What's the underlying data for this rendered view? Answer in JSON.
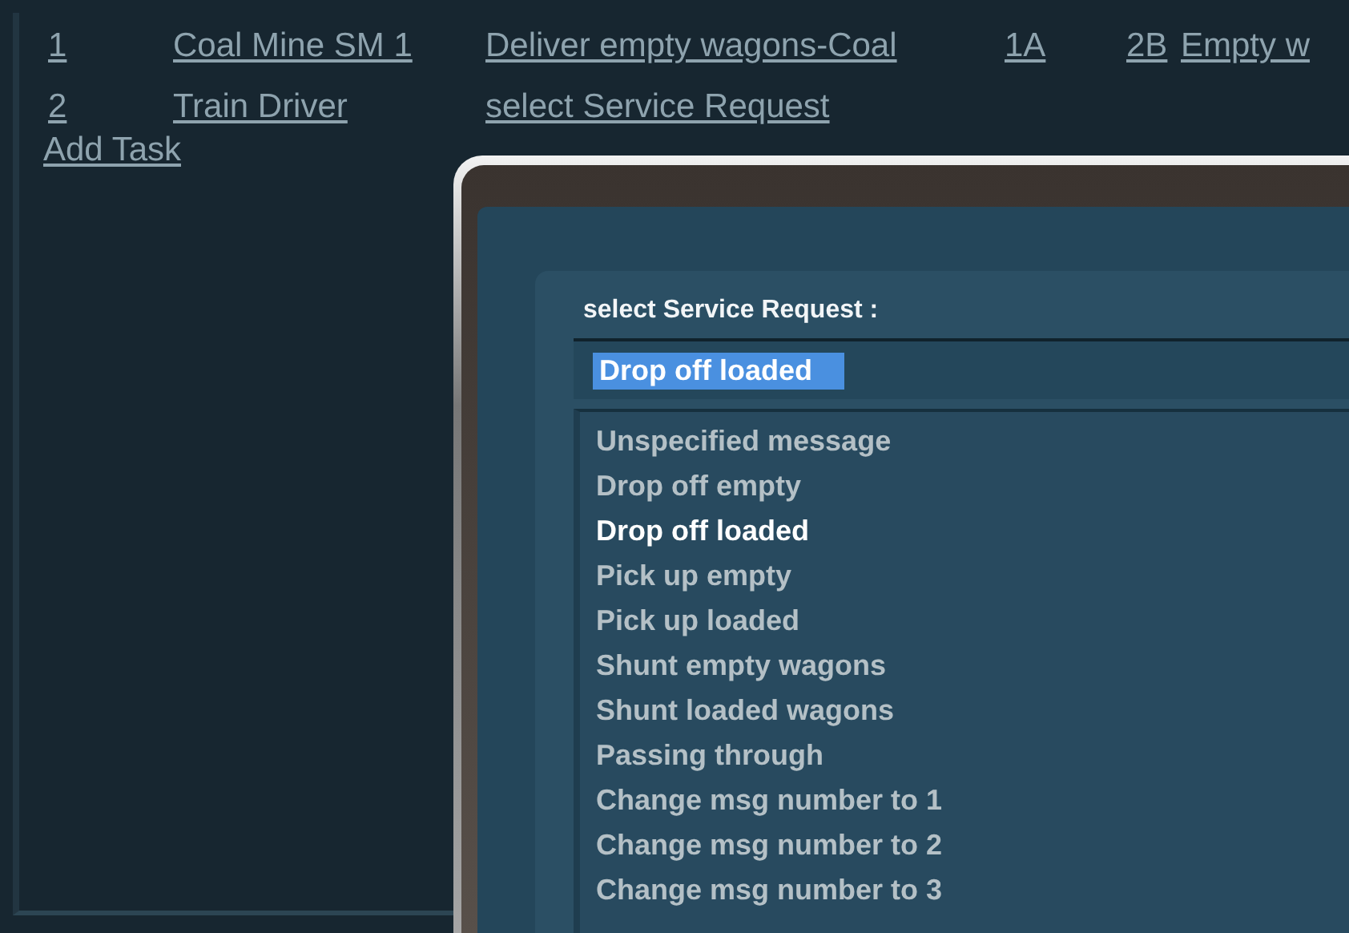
{
  "tasks": [
    {
      "number": "1",
      "cells": [
        "Coal Mine SM 1",
        "Deliver empty wagons-Coal",
        "1A",
        "2B",
        "Empty w"
      ]
    },
    {
      "number": "2",
      "cells": [
        "Train Driver",
        "select Service Request"
      ]
    }
  ],
  "add_task": "Add Task",
  "dialog": {
    "label": "select Service Request :",
    "value": "Drop off loaded",
    "options": [
      {
        "label": "Unspecified message",
        "selected": false
      },
      {
        "label": "Drop off empty",
        "selected": false
      },
      {
        "label": "Drop off loaded",
        "selected": true
      },
      {
        "label": "Pick up empty",
        "selected": false
      },
      {
        "label": "Pick up loaded",
        "selected": false
      },
      {
        "label": "Shunt empty wagons",
        "selected": false
      },
      {
        "label": "Shunt loaded wagons",
        "selected": false
      },
      {
        "label": "Passing through",
        "selected": false
      },
      {
        "label": "Change msg number to 1",
        "selected": false
      },
      {
        "label": "Change msg number to 2",
        "selected": false
      },
      {
        "label": "Change msg number to 3",
        "selected": false
      }
    ]
  }
}
